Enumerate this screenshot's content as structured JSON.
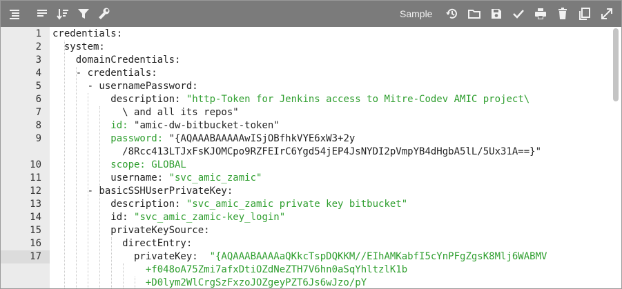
{
  "toolbar": {
    "left_icons": [
      "format-icon",
      "list-icon",
      "sort-icon",
      "filter-icon",
      "wrench-icon"
    ],
    "sample_label": "Sample",
    "right_icons": [
      "history-icon",
      "folder-icon",
      "save-icon",
      "check-icon",
      "print-icon",
      "trash-icon",
      "copy-icon",
      "fullscreen-icon"
    ]
  },
  "colors": {
    "toolbar_bg": "#7b7b7b",
    "gutter_bg": "#ebebeb",
    "string_green": "#2e9e2e",
    "key_green": "#2e9e2e"
  },
  "editor": {
    "active_line": "17",
    "lines": [
      {
        "num": "1",
        "parts": [
          [
            "",
            "credentials:"
          ]
        ]
      },
      {
        "num": "2",
        "parts": [
          [
            "",
            "  system:"
          ]
        ]
      },
      {
        "num": "3",
        "parts": [
          [
            "",
            "    domainCredentials:"
          ]
        ]
      },
      {
        "num": "4",
        "parts": [
          [
            "",
            "    - credentials:"
          ]
        ]
      },
      {
        "num": "5",
        "parts": [
          [
            "",
            "      - usernamePassword:"
          ]
        ]
      },
      {
        "num": "6",
        "parts": [
          [
            "",
            "          description: "
          ],
          [
            "str",
            "\"http-Token for Jenkins access to Mitre-Codev AMIC project\\"
          ]
        ]
      },
      {
        "num": "7",
        "parts": [
          [
            "",
            "            \\ and all its repos\""
          ]
        ]
      },
      {
        "num": "8",
        "parts": [
          [
            "kw",
            "          id: "
          ],
          [
            "",
            "\"amic-dw-bitbucket-token\""
          ]
        ]
      },
      {
        "num": "9",
        "parts": [
          [
            "kw",
            "          password: "
          ],
          [
            "",
            "\"{AQAAABAAAAAwISjOBfhkVYE6xW3+2y"
          ]
        ]
      },
      {
        "num": "",
        "parts": [
          [
            "",
            "            /8Rcc413LTJxFsKJOMCpo9RZFEIrC6Ygd54jEP4JsNYDI2pVmpYB4dHgbA5lL/5Ux31A==}\""
          ]
        ]
      },
      {
        "num": "10",
        "parts": [
          [
            "kw",
            "          scope: GLOBAL"
          ]
        ]
      },
      {
        "num": "11",
        "parts": [
          [
            "",
            "          username: "
          ],
          [
            "str",
            "\"svc_amic_zamic\""
          ]
        ]
      },
      {
        "num": "12",
        "parts": [
          [
            "",
            "      - basicSSHUserPrivateKey:"
          ]
        ]
      },
      {
        "num": "13",
        "parts": [
          [
            "",
            "          description: "
          ],
          [
            "str",
            "\"svc_amic_zamic private key bitbucket\""
          ]
        ]
      },
      {
        "num": "14",
        "parts": [
          [
            "",
            "          id: "
          ],
          [
            "str",
            "\"svc_amic_zamic-key_login\""
          ]
        ]
      },
      {
        "num": "15",
        "parts": [
          [
            "",
            "          privateKeySource:"
          ]
        ]
      },
      {
        "num": "16",
        "parts": [
          [
            "",
            "            directEntry:"
          ]
        ]
      },
      {
        "num": "17",
        "parts": [
          [
            "",
            "              privateKey:  "
          ],
          [
            "str",
            "\"{AQAAABAAAAaQKkcTspDQKKM//EIhAMKabfI5cYnPFgZgsK8Mlj6WABMV"
          ]
        ]
      },
      {
        "num": "",
        "parts": [
          [
            "str",
            "                +f048oA75Zmi7afxDtiOZdNeZTH7V6hn0aSqYhltzlK1b"
          ]
        ]
      },
      {
        "num": "",
        "parts": [
          [
            "str",
            "                +D0lym2WlCrgSzFxzoJOZgeyPZT6Js6wJzo/pY"
          ]
        ]
      }
    ]
  }
}
